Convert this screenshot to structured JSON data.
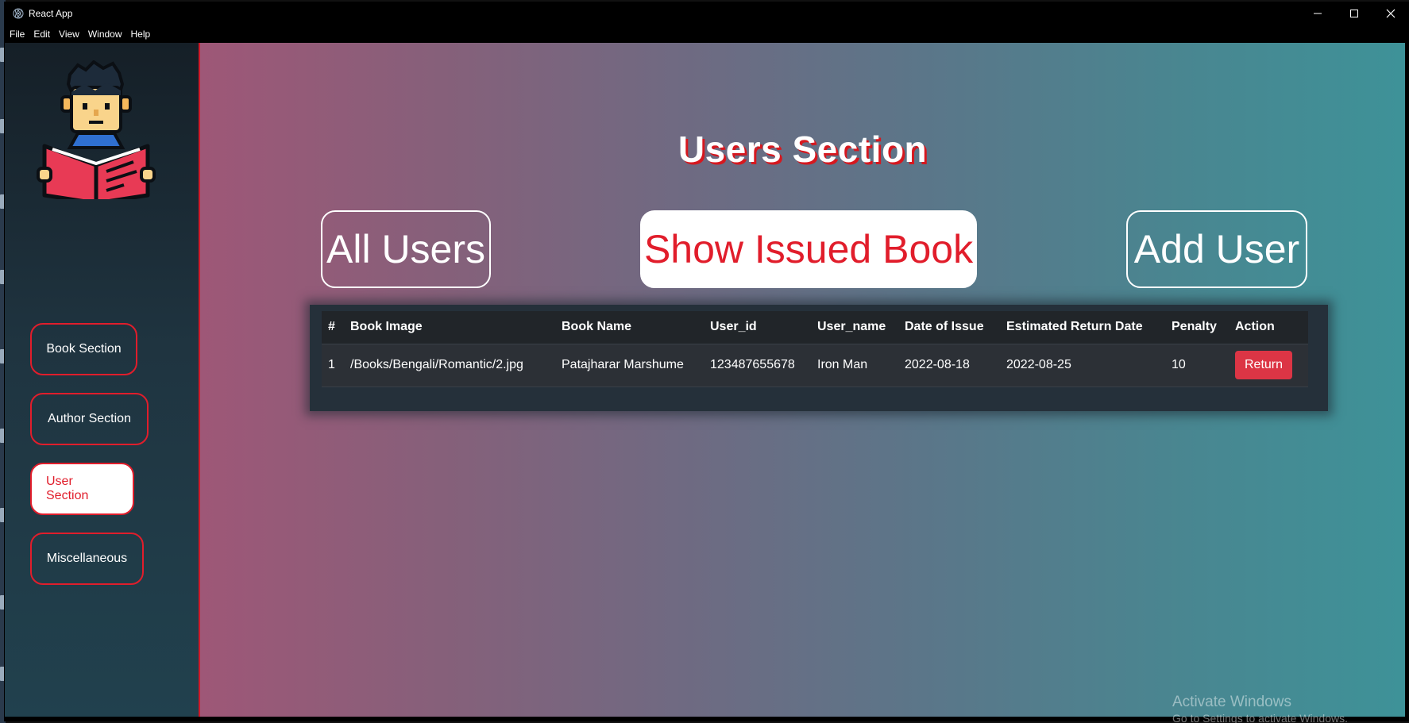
{
  "window": {
    "title": "React App"
  },
  "menu": [
    "File",
    "Edit",
    "View",
    "Window",
    "Help"
  ],
  "sidebar": {
    "items": [
      {
        "label": "Book Section",
        "active": false
      },
      {
        "label": "Author Section",
        "active": false
      },
      {
        "label": "User Section",
        "active": true
      },
      {
        "label": "Miscellaneous",
        "active": false
      }
    ]
  },
  "main": {
    "title": "Users Section",
    "buttons": {
      "all_users": "All Users",
      "show_issued": "Show Issued Book",
      "add_user": "Add User"
    },
    "table": {
      "headers": [
        "#",
        "Book Image",
        "Book Name",
        "User_id",
        "User_name",
        "Date of Issue",
        "Estimated Return Date",
        "Penalty",
        "Action"
      ],
      "rows": [
        {
          "num": "1",
          "book_image": "/Books/Bengali/Romantic/2.jpg",
          "book_name": "Patajharar Marshume",
          "user_id": "123487655678",
          "user_name": "Iron Man",
          "date_of_issue": "2022-08-18",
          "return_date": "2022-08-25",
          "penalty": "10",
          "action": "Return"
        }
      ]
    }
  },
  "os_watermark": {
    "line1": "Activate Windows",
    "line2": "Go to Settings to activate Windows."
  },
  "colors": {
    "accent_red": "#e11d2b",
    "return_button": "#dc3545",
    "table_bg": "#25303a"
  },
  "icons": {
    "app": "electron-icon",
    "logo": "reader-boy-logo"
  }
}
